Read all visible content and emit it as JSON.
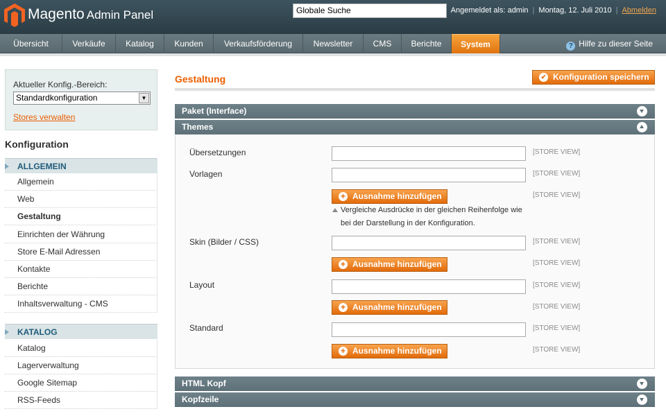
{
  "header": {
    "logo_text": "Magento",
    "logo_suffix": "Admin Panel",
    "search_value": "Globale Suche",
    "logged_in": "Angemeldet als: admin",
    "date": "Montag, 12. Juli 2010",
    "logout": "Abmelden"
  },
  "nav": {
    "items": [
      "Übersicht",
      "Verkäufe",
      "Katalog",
      "Kunden",
      "Verkaufsförderung",
      "Newsletter",
      "CMS",
      "Berichte",
      "System"
    ],
    "active": "System",
    "help": "Hilfe zu dieser Seite"
  },
  "sidebar": {
    "scope_label": "Aktueller Konfig.-Bereich:",
    "scope_value": "Standardkonfiguration",
    "stores_link": "Stores verwalten",
    "title": "Konfiguration",
    "group1": "ALLGEMEIN",
    "group1_items": [
      "Allgemein",
      "Web",
      "Gestaltung",
      "Einrichten der Währung",
      "Store E-Mail Adressen",
      "Kontakte",
      "Berichte",
      "Inhaltsverwaltung - CMS"
    ],
    "active_item": "Gestaltung",
    "group2": "KATALOG",
    "group2_items": [
      "Katalog",
      "Lagerverwaltung",
      "Google Sitemap",
      "RSS-Feeds"
    ]
  },
  "main": {
    "title": "Gestaltung",
    "save_label": "Konfiguration speichern",
    "sections": [
      "Paket (Interface)",
      "Themes",
      "HTML Kopf",
      "Kopfzeile"
    ],
    "fields": {
      "translations": "Übersetzungen",
      "templates": "Vorlagen",
      "skin": "Skin (Bilder / CSS)",
      "layout": "Layout",
      "default": "Standard"
    },
    "scope_tag": "[STORE VIEW]",
    "add_exception": "Ausnahme hinzufügen",
    "note": "Vergleiche Ausdrücke in der gleichen Reihenfolge wie bei der Darstellung in der Konfiguration."
  },
  "colors": {
    "accent": "#eb5e00",
    "header_bg": "#2b3c44",
    "section_head": "#5e7078"
  }
}
